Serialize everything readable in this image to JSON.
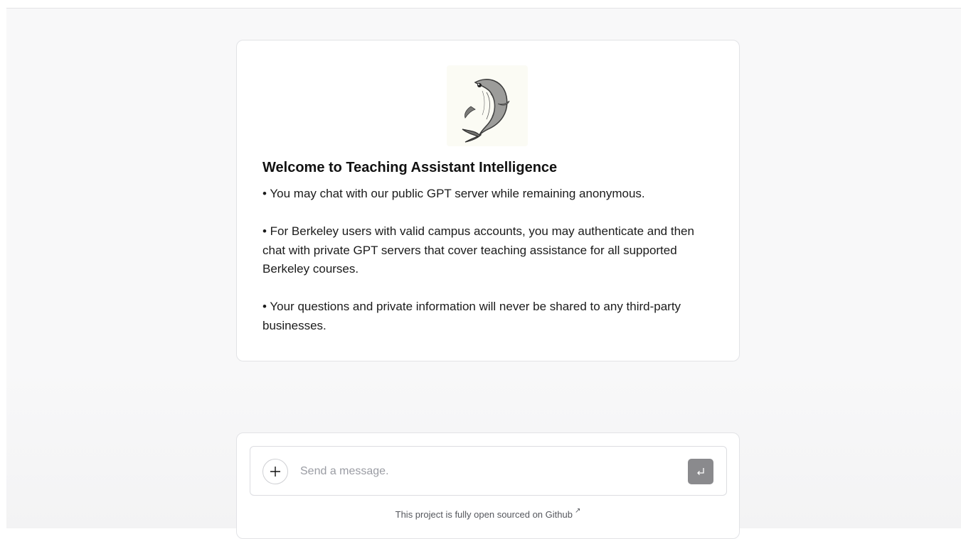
{
  "welcome": {
    "logo_icon": "koi-fish-logo",
    "title": "Welcome to Teaching Assistant Intelligence",
    "bullets": [
      "• You may chat with our public GPT server while remaining anonymous.",
      "• For Berkeley users with valid campus accounts, you may authenticate and then chat with private GPT servers that cover teaching assistance for all supported Berkeley courses.",
      "• Your questions and private information will never be shared to any third-party businesses."
    ]
  },
  "composer": {
    "attach_icon": "plus-icon",
    "placeholder": "Send a message.",
    "value": "",
    "send_icon": "enter-return-icon"
  },
  "footer": {
    "text": "This project is fully open sourced on ",
    "link_label": "Github",
    "link_icon": "↗"
  },
  "colors": {
    "background": "#f8f8f9",
    "card": "#ffffff",
    "border": "#e2e3e6",
    "send_button": "#8a8a8d"
  }
}
